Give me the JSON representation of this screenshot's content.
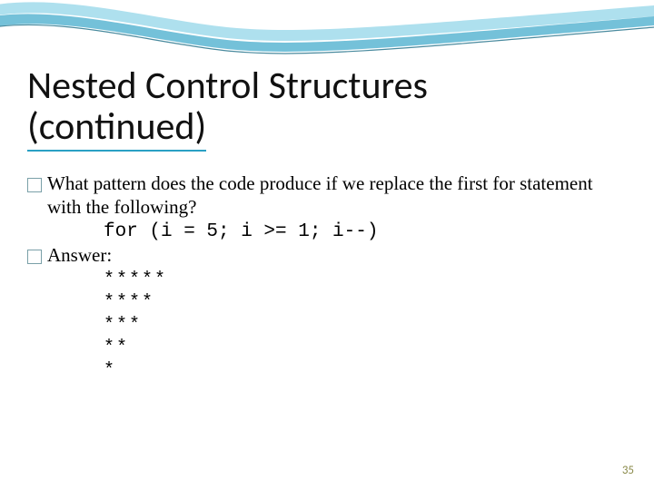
{
  "title_line1": "Nested Control Structures",
  "title_line2": "(continued)",
  "bullet1": "What pattern does the code produce if we replace the first for statement with the following?",
  "code": "for (i = 5; i >= 1; i--)",
  "bullet2": "Answer:",
  "stars": [
    "*****",
    "****",
    "***",
    "**",
    "*"
  ],
  "page_number": "35"
}
